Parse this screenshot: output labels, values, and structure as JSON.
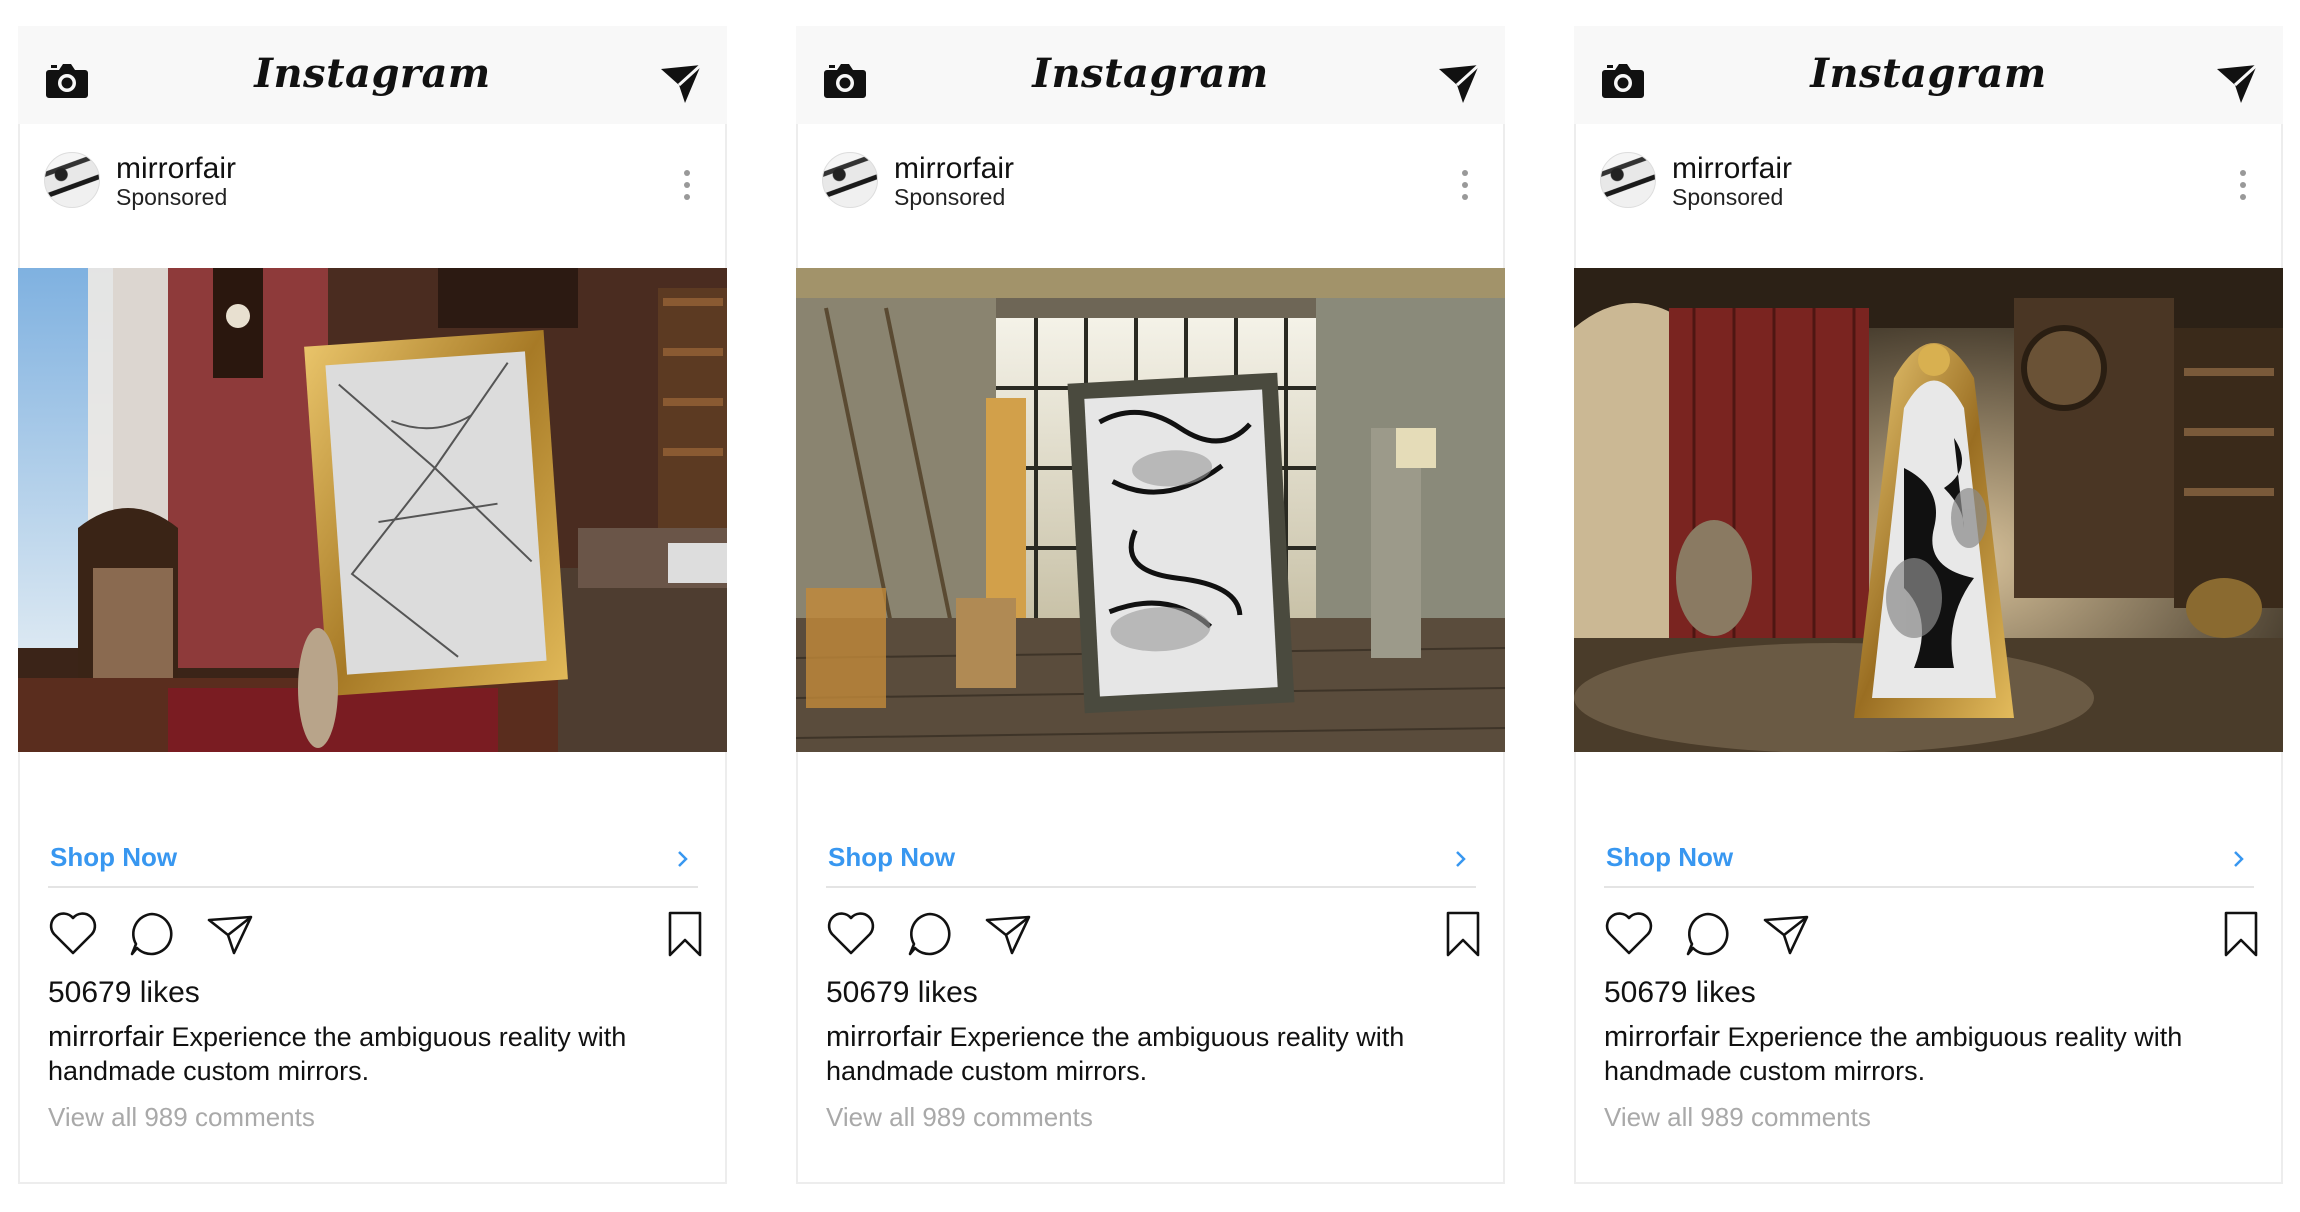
{
  "app_name": "Instagram",
  "colors": {
    "link": "#3897f0",
    "topbar": "#f8f8f8",
    "muted": "#a9a9a9"
  },
  "icons": {
    "camera": "camera-icon",
    "direct": "paper-plane-icon",
    "more": "vertical-dots-icon",
    "like": "heart-icon",
    "comment": "speech-bubble-icon",
    "share": "paper-plane-icon",
    "save": "bookmark-icon",
    "shop": "chevron-right-icon"
  },
  "posts": [
    {
      "username": "mirrorfair",
      "sponsored": "Sponsored",
      "cta": "Shop Now",
      "likes": "50679 likes",
      "caption_user": "mirrorfair",
      "caption_text": " Experience the ambiguous reality with handmade custom mirrors.",
      "view_comments": "View all 989 comments"
    },
    {
      "username": "mirrorfair",
      "sponsored": "Sponsored",
      "cta": "Shop Now",
      "likes": "50679 likes",
      "caption_user": "mirrorfair",
      "caption_text": " Experience the ambiguous reality with handmade custom mirrors.",
      "view_comments": "View all 989 comments"
    },
    {
      "username": "mirrorfair",
      "sponsored": "Sponsored",
      "cta": "Shop Now",
      "likes": "50679 likes",
      "caption_user": "mirrorfair",
      "caption_text": " Experience the ambiguous reality with handmade custom mirrors.",
      "view_comments": "View all 989 comments"
    }
  ]
}
